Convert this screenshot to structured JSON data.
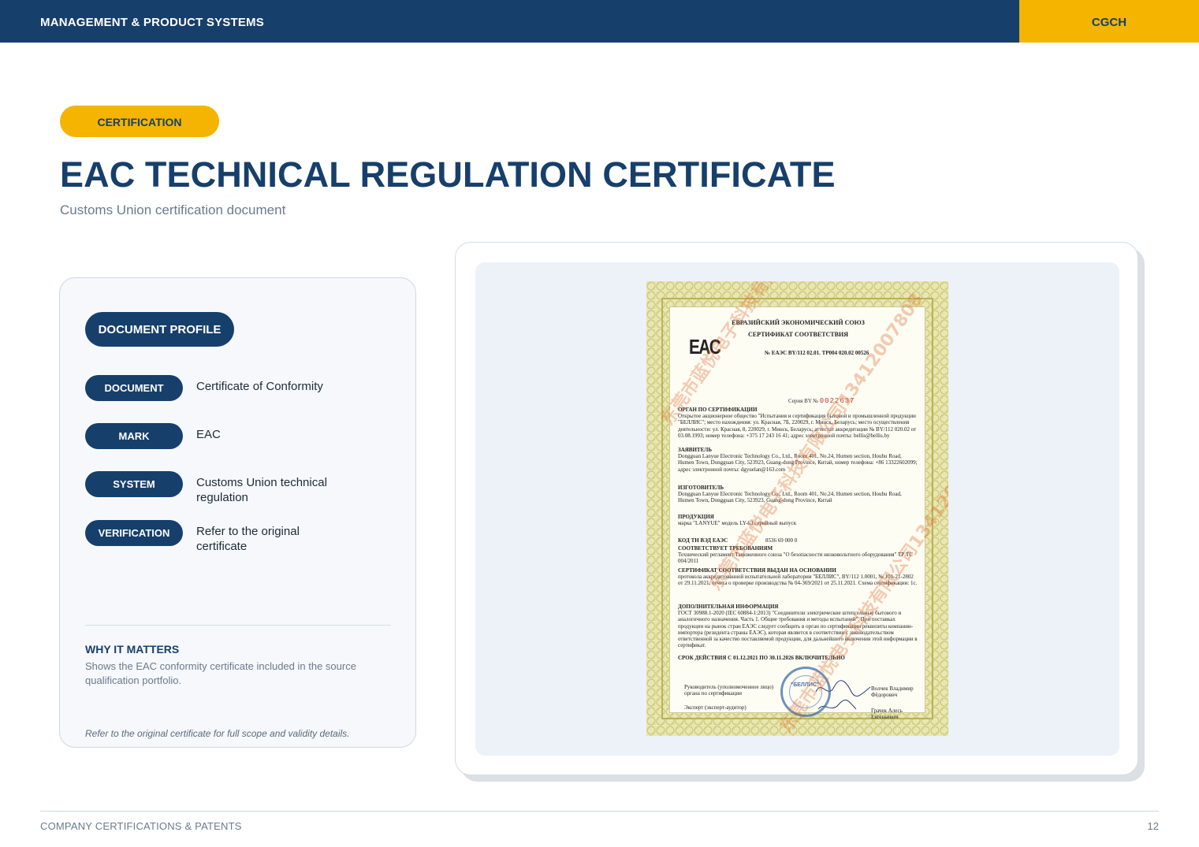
{
  "header": {
    "section_title": "MANAGEMENT & PRODUCT SYSTEMS",
    "brand": "CGCH"
  },
  "category_label": "CERTIFICATION",
  "title": "EAC TECHNICAL REGULATION CERTIFICATE",
  "subtitle": "Customs Union certification document",
  "profile": {
    "heading": "DOCUMENT PROFILE",
    "rows": [
      {
        "label": "DOCUMENT",
        "value": "Certificate of Conformity"
      },
      {
        "label": "MARK",
        "value": "EAC"
      },
      {
        "label": "SYSTEM",
        "value": "Customs Union technical regulation"
      },
      {
        "label": "VERIFICATION",
        "value": "Refer to the original certificate"
      }
    ],
    "why_heading": "WHY IT MATTERS",
    "why_text": "Shows the EAC conformity certificate included in the source qualification portfolio.",
    "footnote": "Refer to the original certificate for full scope and validity details."
  },
  "certificate": {
    "union": "ЕВРАЗИЙСКИЙ ЭКОНОМИЧЕСКИЙ СОЮЗ",
    "doc_type": "СЕРТИФИКАТ СООТВЕТСТВИЯ",
    "number": "№ ЕАЭС BY/112 02.01. ТР004 020.02 00526",
    "mark": "EAC",
    "series_label": "Серия BY   №",
    "series_number": "0022637",
    "sections": [
      {
        "heading": "ОРГАН ПО СЕРТИФИКАЦИИ",
        "text": "Открытое акционерное общество \"Испытания и сертификация бытовой и промышленной продукции \"БЕЛЛИС\"; место нахождения: ул. Красная, 7Б, 220029, г. Минск, Беларусь; место осуществления деятельности: ул. Красная, 8, 220029, г. Минск, Беларусь; аттестат аккредитации № BY/112 020.02 от 03.08.1993; номер телефона: +375 17 243 16 41; адрес электронной почты: bellis@bellis.by"
      },
      {
        "heading": "ЗАЯВИТЕЛЬ",
        "text": "Dongguan Lanyue Electronic Technology Co., Ltd., Room 401, No.24, Humen section, Houhu Road, Humen Town, Dongguan City, 523923, Guang-dong Province, Китай, номер телефона: +86 13322602099; адрес электронной почты: dgyuelan@163.com"
      },
      {
        "heading": "ИЗГОТОВИТЕЛЬ",
        "text": "Dongguan Lanyue Electronic Technology Co., Ltd., Room 401, No.24, Humen section, Houhu Road, Humen Town, Dongguan City, 523923, Guang-dong Province, Китай"
      },
      {
        "heading": "ПРОДУКЦИЯ",
        "text": "марка \"LANYUE\" модель LY-63 серийный выпуск"
      },
      {
        "heading": "КОД ТН ВЭД ЕАЭС",
        "text": "8536 69 000 0"
      },
      {
        "heading": "СООТВЕТСТВУЕТ ТРЕБОВАНИЯМ",
        "text": "Технический регламент Таможенного союза \"О безопасности низковольтного оборудования\" ТР ТС 004/2011"
      },
      {
        "heading": "СЕРТИФИКАТ СООТВЕТСТВИЯ ВЫДАН НА ОСНОВАНИИ",
        "text": "протокола аккредитованной испытательной лаборатории \"БЕЛЛИС\", BY/112 1.0001, № 101-21-2802 от 29.11.2021, отчета о проверке производства № 04-369/2021 от 25.11.2021. Схема сертификации: 1с."
      },
      {
        "heading": "ДОПОЛНИТЕЛЬНАЯ ИНФОРМАЦИЯ",
        "text": "ГОСТ 30988.1-2020 (IEC 60884-1:2013) \"Соединители электрические штепсельные бытового и аналогичного назначения. Часть 1. Общие требования и методы испытаний\". При поставках продукции на рынок стран ЕАЭС следует сообщить в орган по сертификации реквизиты компании-импортера (резидента страны ЕАЭС), которая является в соответствии с законодательством ответственной за качество поставляемой продукции, для дальнейшего включения этой информации в сертификат."
      }
    ],
    "validity": "СРОК ДЕЙСТВИЯ С 01.12.2021 ПО 30.11.2026 ВКЛЮЧИТЕЛЬНО",
    "head_label": "Руководитель (уполномоченное лицо) органа по сертификации",
    "head_name": "Волчек Владимир Фёдорович",
    "expert_label": "Эксперт (эксперт-аудитор)",
    "expert_name": "Грачек Алесь Евгеньевич",
    "stamp_text": "\"БЕЛЛИС\"",
    "watermark": "东莞市蓝悦电子科技有限公司13412007808"
  },
  "footer": {
    "left": "COMPANY CERTIFICATIONS & PATENTS",
    "page_number": "12"
  },
  "colors": {
    "navy": "#173f6b",
    "accent": "#f4b400",
    "muted": "#6b7b8c"
  }
}
